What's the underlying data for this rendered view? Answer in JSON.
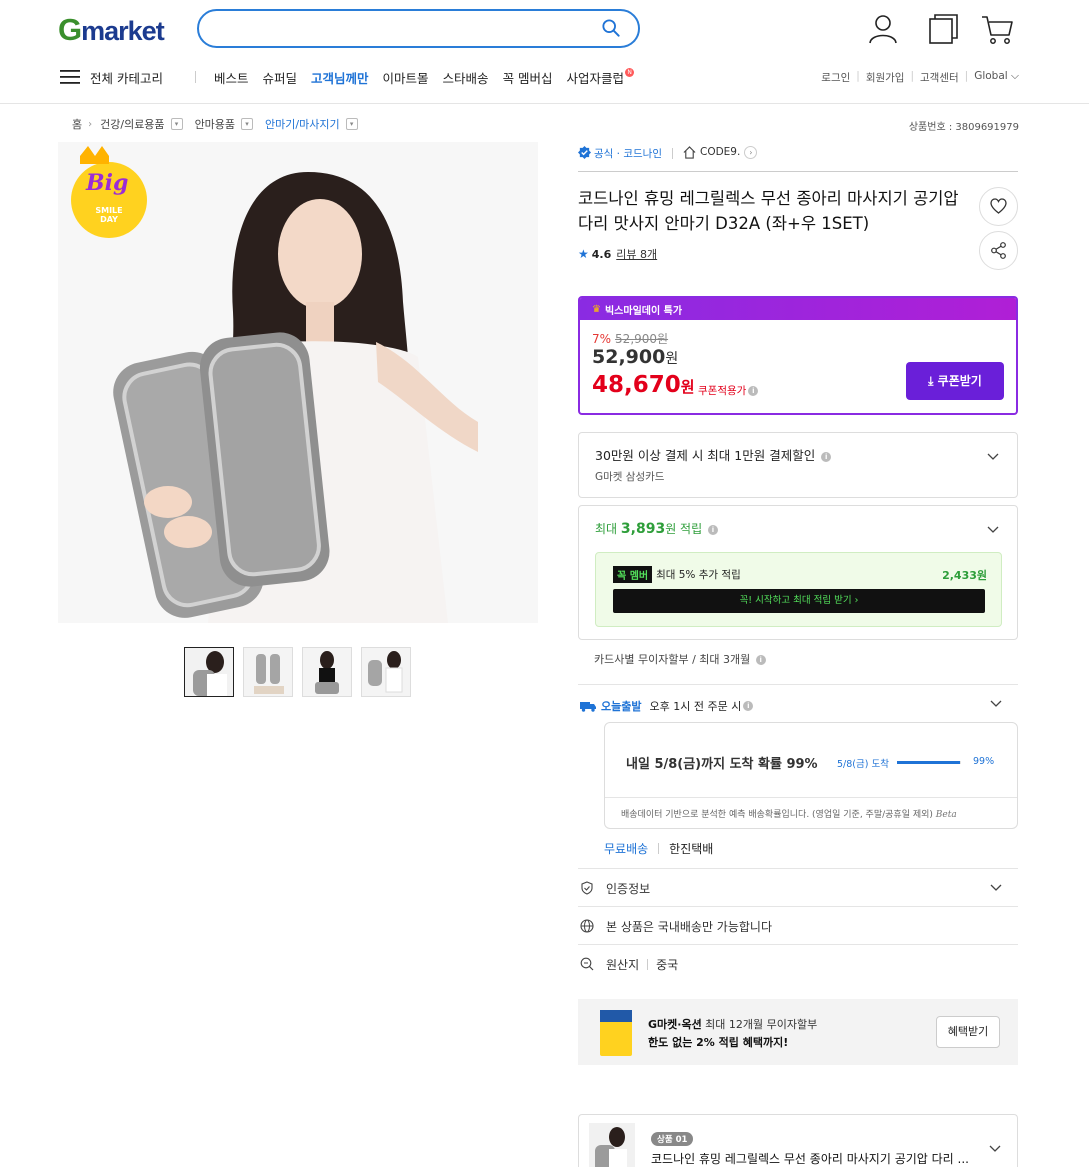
{
  "header": {
    "logo_g": "G",
    "logo_rest": "market",
    "search_placeholder": "",
    "nav": {
      "all_categories": "전체 카테고리",
      "items": [
        "베스트",
        "슈퍼딜",
        "고객님께만",
        "이마트몰",
        "스타배송",
        "꼭 멤버십",
        "사업자클럽"
      ],
      "badge": "N"
    },
    "utils": [
      "로그인",
      "회원가입",
      "고객센터",
      "Global"
    ]
  },
  "breadcrumb": {
    "items": [
      "홈",
      "건강/의료용품",
      "안마용품",
      "안마기/마사지기"
    ],
    "product_no": "상품번호 : 3809691979"
  },
  "image": {
    "badge_big": "Big",
    "badge_line1": "SMILE",
    "badge_line2": "DAY"
  },
  "shop": {
    "official": "공식 · 코드나인",
    "store": "CODE9."
  },
  "product": {
    "title": "코드나인 휴밍 레그릴렉스 무선 종아리 마사지기 공기압 다리 맛사지 안마기 D32A (좌+우 1SET)",
    "rating": "4.6",
    "review_label": "리뷰 8개"
  },
  "deal": {
    "banner": "빅스마일데이 특가",
    "discount": "7%",
    "original_price": "52,900원",
    "price": "52,900",
    "price_unit": "원",
    "coupon_price": "48,670",
    "coupon_price_unit": "원",
    "coupon_label": "쿠폰적용가",
    "coupon_button": "쿠폰받기"
  },
  "card_discount": {
    "title": "30만원 이상 결제 시 최대 1만원 결제할인",
    "sub": "G마켓 삼성카드"
  },
  "points": {
    "prefix": "최대 ",
    "amount": "3,893",
    "suffix": "원 적립",
    "member_badge1": "꼭",
    "member_badge2": "멤버",
    "member_text": "최대 5% 추가 적립",
    "member_amount": "2,433원",
    "member_cta": "꼭! 시작하고 최대 적립 받기  ›"
  },
  "installment": "카드사별 무이자할부 / 최대 3개월",
  "delivery": {
    "today_label": "오늘출발",
    "cutoff": "오후 1시 전 주문 시",
    "arrival_text": "내일 5/8(금)까지 도착 확률 99%",
    "bar_label": "5/8(금) 도착",
    "bar_percent": "99%",
    "bar_value": 0.99,
    "note": "배송데이터 기반으로 분석한 예측 배송확률입니다. (영업일 기준, 주말/공휴일 제외)",
    "note_beta": "Beta",
    "free": "무료배송",
    "courier": "한진택배"
  },
  "rows": {
    "cert": "인증정보",
    "domestic": "본 상품은 국내배송만 가능합니다",
    "origin_label": "원산지",
    "origin_value": "중국"
  },
  "benefit": {
    "line1_bold": "G마켓·옥션",
    "line1_rest": " 최대 12개월 무이자할부",
    "line2": "한도 없는 2% 적립 혜택까지!",
    "button": "혜택받기"
  },
  "option": {
    "tag": "상품 01",
    "name": "코드나인 휴밍 레그릴렉스 무선 종아리 마사지기 공기압 다리 ..."
  },
  "colors": {
    "accent_blue": "#1f73d6",
    "deal_purple": "#8a2be2",
    "price_red": "#e3001b",
    "point_green": "#2e9e3a"
  }
}
